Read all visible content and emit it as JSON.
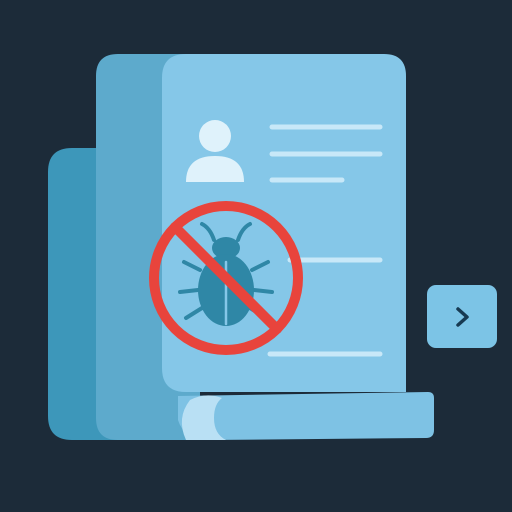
{
  "illustration": {
    "subject": "document-with-no-bugs-icon",
    "icons": {
      "back_sheet": "folder-back-icon",
      "middle_sheet": "document-sheet-icon",
      "front_page": "document-page-icon",
      "user": "user-avatar-icon",
      "prohibited_bug": "no-bug-icon",
      "next": "chevron-right-icon"
    },
    "colors": {
      "background": "#1c2b39",
      "back_sheet": "#3d97ba",
      "middle_sheet": "#5daacc",
      "page": "#85c7e8",
      "page_lines": "#c8e8f8",
      "user": "#dff2fb",
      "bug": "#2f87a6",
      "prohibition": "#e8443c",
      "accent": "#7cc4e6",
      "chevron": "#173a52"
    }
  }
}
